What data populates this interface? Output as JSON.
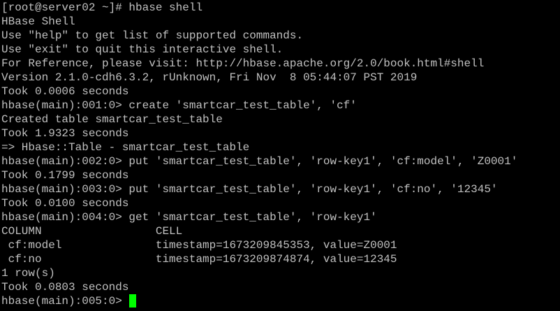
{
  "terminal": {
    "lines": [
      "[root@server02 ~]# hbase shell",
      "HBase Shell",
      "Use \"help\" to get list of supported commands.",
      "Use \"exit\" to quit this interactive shell.",
      "For Reference, please visit: http://hbase.apache.org/2.0/book.html#shell",
      "Version 2.1.0-cdh6.3.2, rUnknown, Fri Nov  8 05:44:07 PST 2019",
      "Took 0.0006 seconds",
      "hbase(main):001:0> create 'smartcar_test_table', 'cf'",
      "Created table smartcar_test_table",
      "Took 1.9323 seconds",
      "=> Hbase::Table - smartcar_test_table",
      "hbase(main):002:0> put 'smartcar_test_table', 'row-key1', 'cf:model', 'Z0001'",
      "Took 0.1799 seconds",
      "hbase(main):003:0> put 'smartcar_test_table', 'row-key1', 'cf:no', '12345'",
      "Took 0.0100 seconds",
      "hbase(main):004:0> get 'smartcar_test_table', 'row-key1'",
      "COLUMN                 CELL",
      " cf:model              timestamp=1673209845353, value=Z0001",
      " cf:no                 timestamp=1673209874874, value=12345",
      "1 row(s)",
      "Took 0.0803 seconds"
    ],
    "prompt": "hbase(main):005:0> ",
    "colors": {
      "background": "#000000",
      "foreground": "#c0c0c0",
      "cursor": "#00ff00"
    }
  }
}
